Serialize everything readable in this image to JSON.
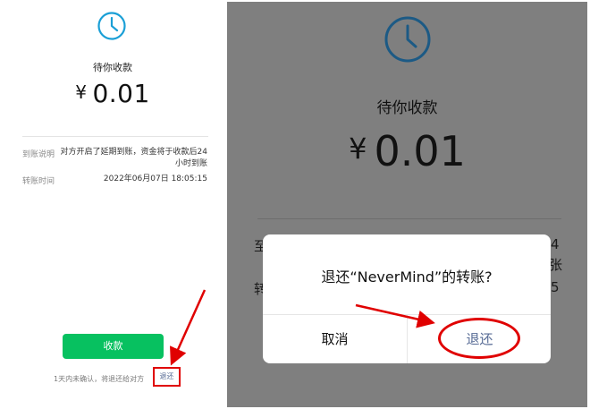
{
  "left_panel": {
    "status_text": "待你收款",
    "currency_symbol": "¥",
    "amount": "0.01",
    "details": [
      {
        "label": "到账说明",
        "value_line1": "对方开启了延期到账，资金将于收款后24",
        "value_line2": "小时到账"
      },
      {
        "label": "转账时间",
        "value_line1": "2022年06月07日 18:05:15",
        "value_line2": ""
      }
    ],
    "receive_button": "收款",
    "footnote": "1天内未确认，将退还给对方",
    "return_link": "退还"
  },
  "right_panel": {
    "status_text": "待你收款",
    "currency_symbol": "¥",
    "amount": "0.01",
    "peek_chars": {
      "a": "至",
      "b": "转",
      "c": "4",
      "d": "张",
      "e": "5"
    },
    "dialog": {
      "message": "退还“NeverMind”的转账?",
      "cancel": "取消",
      "confirm": "退还"
    }
  },
  "colors": {
    "wechat_green": "#07c160",
    "link_blue": "#576b95",
    "annotation_red": "#e00000",
    "clock_blue": "#1a9fd6",
    "overlay_gray": "#7f7f7f"
  },
  "icons": [
    "clock-icon"
  ]
}
